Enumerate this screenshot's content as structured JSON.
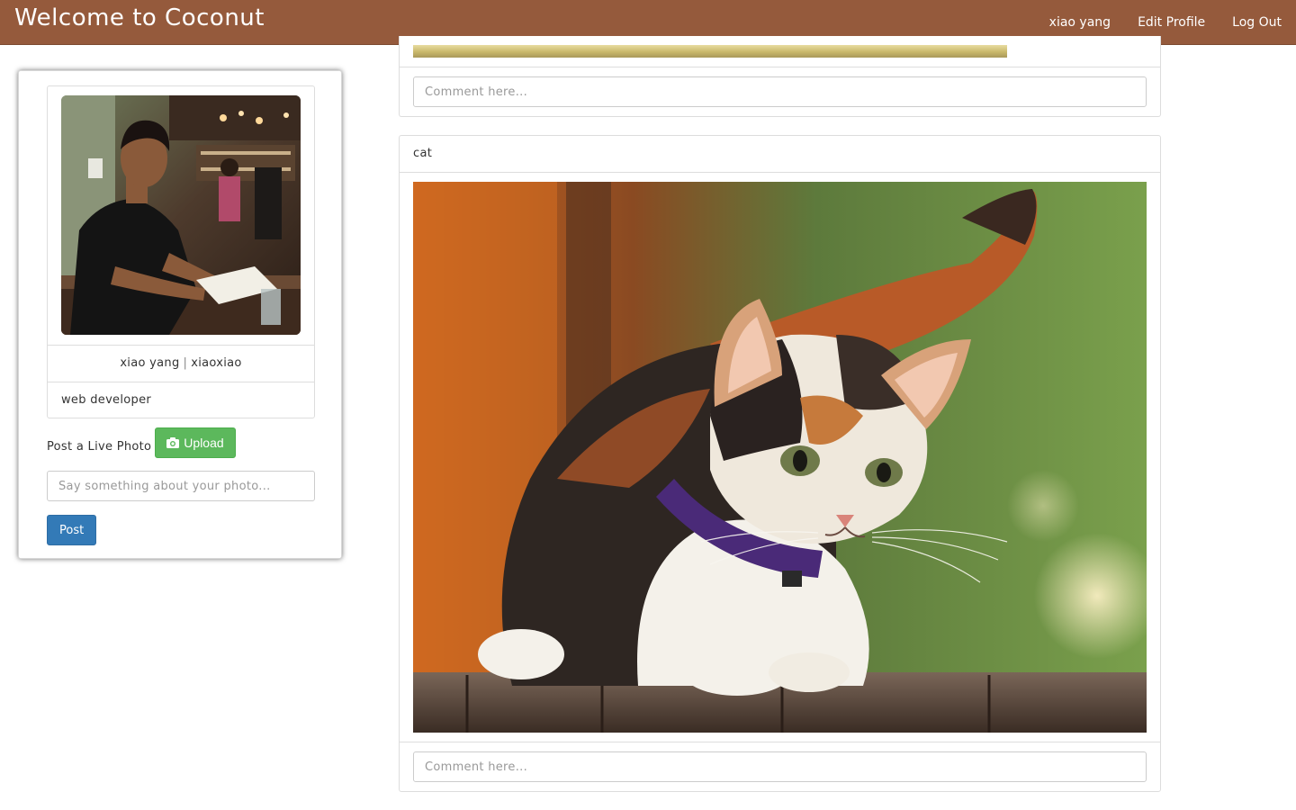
{
  "navbar": {
    "brand": "Welcome to Coconut",
    "links": [
      "xiao yang",
      "Edit Profile",
      "Log Out"
    ],
    "color": "#955a3c"
  },
  "profile": {
    "name": "xiao yang",
    "separator": "|",
    "username": "xiaoxiao",
    "bio": "web developer",
    "upload_label": "Post a Live Photo",
    "upload_button": "Upload",
    "upload_icon": "camera-icon",
    "caption_placeholder": "Say something about your photo...",
    "post_button": "Post"
  },
  "feed": {
    "posts": [
      {
        "caption": "",
        "comment_placeholder": "Comment here..."
      },
      {
        "caption": "cat",
        "comment_placeholder": "Comment here..."
      }
    ]
  },
  "colors": {
    "upload_button": "#5cb85c",
    "post_button": "#337ab7"
  }
}
